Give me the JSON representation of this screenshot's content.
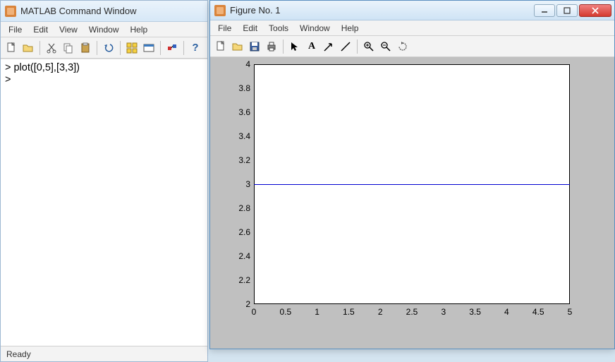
{
  "cmd": {
    "title": "MATLAB Command Window",
    "menus": {
      "file": "File",
      "edit": "Edit",
      "view": "View",
      "window": "Window",
      "help": "Help"
    },
    "body_line1": "> plot([0,5],[3,3])",
    "body_line2": ">",
    "status": "Ready",
    "help_char": "?"
  },
  "fig": {
    "title": "Figure No. 1",
    "menus": {
      "file": "File",
      "edit": "Edit",
      "tools": "Tools",
      "window": "Window",
      "help": "Help"
    },
    "tool_A": "A"
  },
  "chart_data": {
    "type": "line",
    "x": [
      0,
      5
    ],
    "y": [
      3,
      3
    ],
    "xlim": [
      0,
      5
    ],
    "ylim": [
      2,
      4
    ],
    "xticks": [
      0,
      0.5,
      1,
      1.5,
      2,
      2.5,
      3,
      3.5,
      4,
      4.5,
      5
    ],
    "yticks": [
      2,
      2.2,
      2.4,
      2.6,
      2.8,
      3,
      3.2,
      3.4,
      3.6,
      3.8,
      4
    ],
    "xlabel": "",
    "ylabel": "",
    "title": ""
  }
}
